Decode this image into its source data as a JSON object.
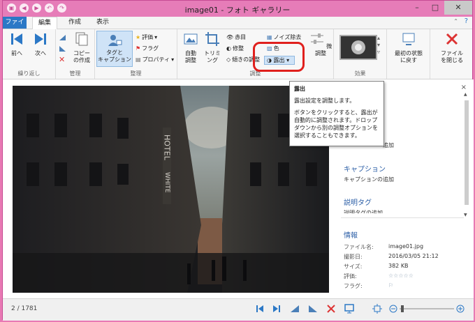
{
  "window": {
    "title": "image01 - フォト ギャラリー"
  },
  "tabs": {
    "file": "ファイル",
    "edit": "編集",
    "create": "作成",
    "view": "表示"
  },
  "ribbon": {
    "nav": {
      "prev": "前へ",
      "next": "次へ",
      "group": "繰り返し"
    },
    "manage": {
      "copy": "コピー\nの作成",
      "group": "管理"
    },
    "organize": {
      "tag_caption": "タグと\nキャプション",
      "rating": "評価",
      "flag": "フラグ",
      "properties": "プロパティ",
      "group": "整理"
    },
    "adjust": {
      "auto": "自動\n調整",
      "trim": "トリミ\nング",
      "redeye": "赤目",
      "retouch": "修整",
      "straighten": "傾きの調整",
      "noise": "ノイズ除去",
      "color": "色",
      "exposure": "露出",
      "fine": "微調整",
      "group": "調整"
    },
    "effects": {
      "group": "効果"
    },
    "revert": {
      "label": "最初の状態\nに戻す"
    },
    "close": {
      "label": "ファイル\nを閉じる"
    }
  },
  "tooltip": {
    "title": "露出",
    "desc": "露出設定を調整します。",
    "help": "ボタンをクリックすると、露出が自動的に調整されます。ドロップダウンから別の調整オプションを選択することもできます。"
  },
  "sidebar": {
    "tag_add": "追加",
    "caption_head": "キャプション",
    "caption_add": "キャプションの追加",
    "desc_head": "説明タグ",
    "desc_add": "説明タグの追加",
    "info_head": "情報",
    "rows": [
      {
        "label": "ファイル名:",
        "value": "image01.jpg"
      },
      {
        "label": "撮影日:",
        "value": "2016/03/05  21:12"
      },
      {
        "label": "サイズ:",
        "value": "382 KB"
      },
      {
        "label": "評価:",
        "value": "☆☆☆☆☆"
      },
      {
        "label": "フラグ:",
        "value": "⚐"
      }
    ]
  },
  "status": {
    "counter": "2 / 1781"
  },
  "photo": {
    "sign1": "HOTEL",
    "sign2": "WHITE"
  },
  "colors": {
    "accent": "#2b78c6",
    "titlebar": "#e67cb8",
    "highlight": "#e0201d"
  }
}
